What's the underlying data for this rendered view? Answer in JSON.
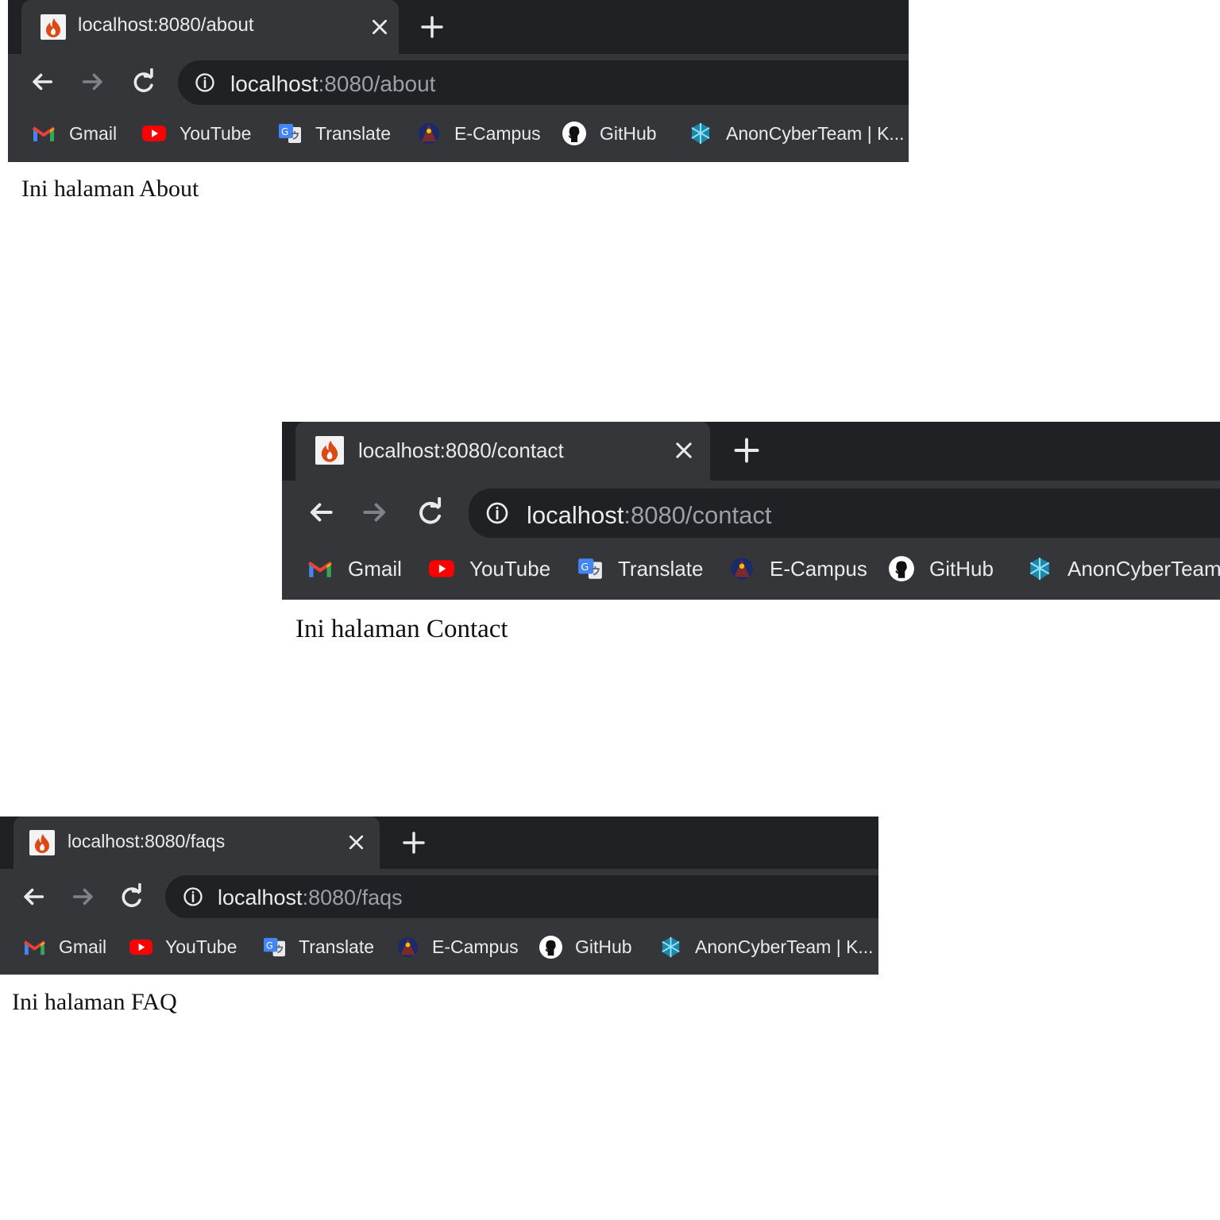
{
  "screenshots": [
    {
      "tab_title": "localhost:8080/about",
      "url_host": "localhost",
      "url_path": ":8080/about",
      "page_text": "Ini halaman About",
      "bookmarks": {
        "gmail": "Gmail",
        "youtube": "YouTube",
        "translate": "Translate",
        "ecampus": "E-Campus",
        "github": "GitHub",
        "anon": "AnonCyberTeam | K..."
      }
    },
    {
      "tab_title": "localhost:8080/contact",
      "url_host": "localhost",
      "url_path": ":8080/contact",
      "page_text": "Ini halaman Contact",
      "bookmarks": {
        "gmail": "Gmail",
        "youtube": "YouTube",
        "translate": "Translate",
        "ecampus": "E-Campus",
        "github": "GitHub",
        "anon": "AnonCyberTeam"
      }
    },
    {
      "tab_title": "localhost:8080/faqs",
      "url_host": "localhost",
      "url_path": ":8080/faqs",
      "page_text": "Ini halaman FAQ",
      "bookmarks": {
        "gmail": "Gmail",
        "youtube": "YouTube",
        "translate": "Translate",
        "ecampus": "E-Campus",
        "github": "GitHub",
        "anon": "AnonCyberTeam | K..."
      }
    }
  ],
  "colors": {
    "tabstrip": "#202124",
    "toolbar": "#35363a",
    "omnibox": "#202124",
    "text_primary": "#e8eaed",
    "text_secondary": "#9aa0a6",
    "page_background": "#ffffff",
    "youtube_red": "#ff0000",
    "translate_blue": "#4285f4",
    "favicon_flame": "#dd4814"
  },
  "icons": {
    "favicon": "flame-favicon-icon",
    "close": "close-icon",
    "new_tab": "plus-icon",
    "back": "arrow-left-icon",
    "forward": "arrow-right-icon",
    "reload": "reload-icon",
    "site_info": "info-circle-icon",
    "gmail": "gmail-icon",
    "youtube": "youtube-icon",
    "translate": "translate-icon",
    "ecampus": "ecampus-icon",
    "github": "github-icon",
    "anon": "anoncyberteam-icon"
  }
}
